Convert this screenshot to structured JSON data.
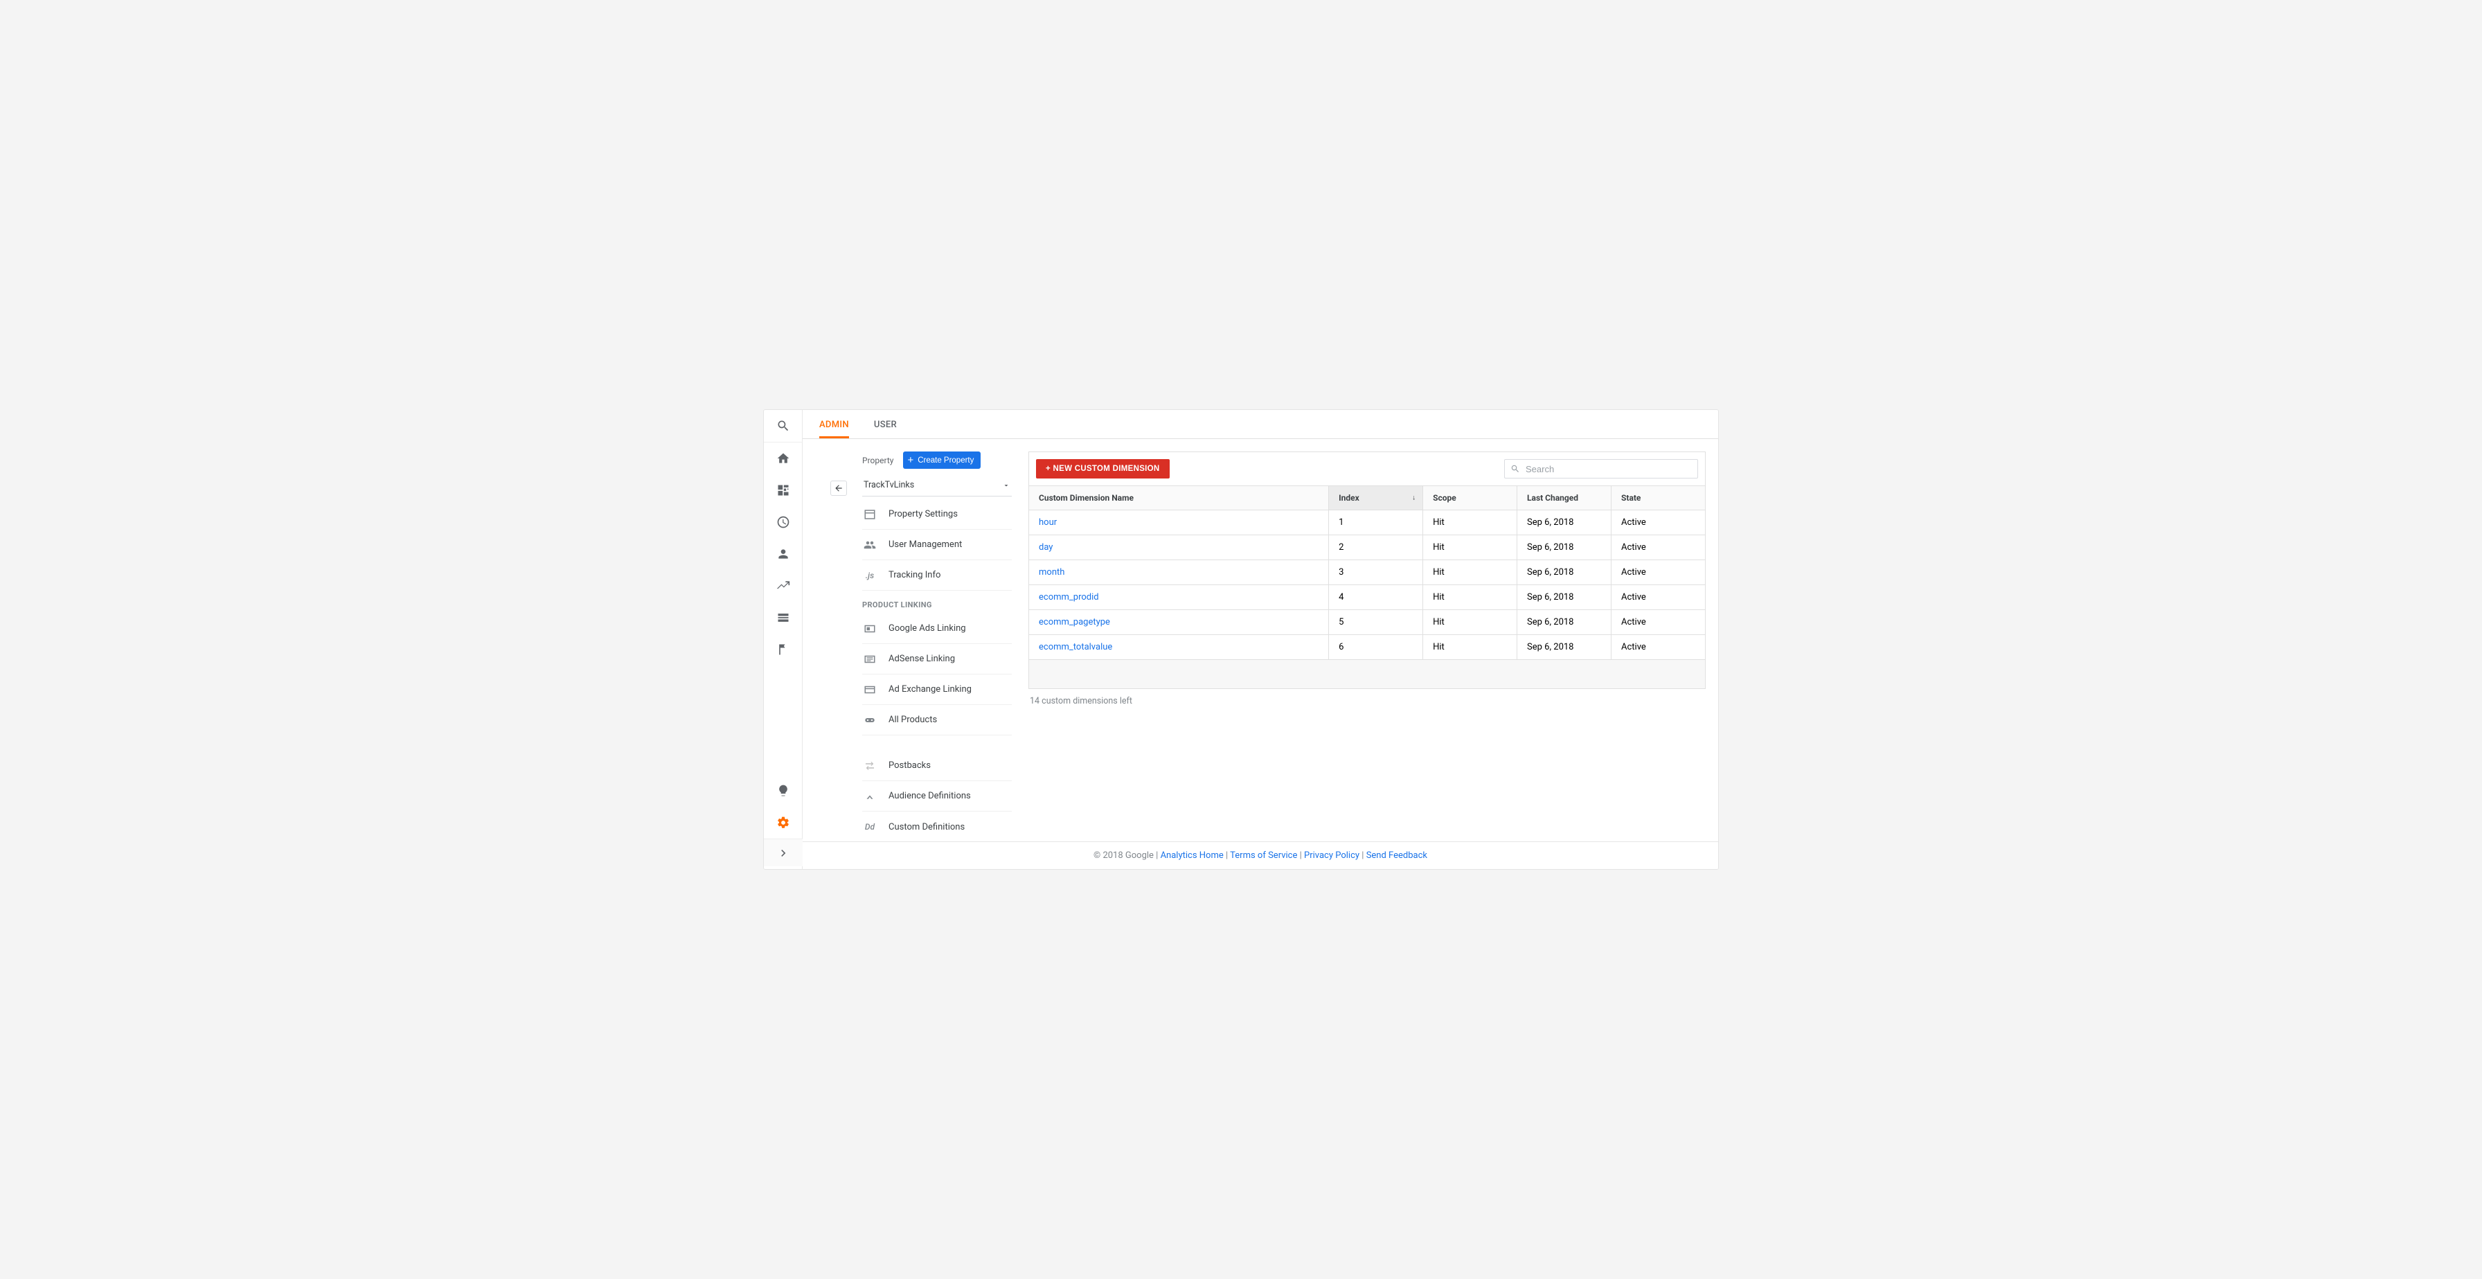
{
  "tabs": {
    "admin": "ADMIN",
    "user": "USER"
  },
  "property": {
    "label": "Property",
    "create_button": "Create Property",
    "selected": "TrackTvLinks"
  },
  "sidebar": {
    "items": [
      {
        "key": "property-settings",
        "label": "Property Settings"
      },
      {
        "key": "user-management",
        "label": "User Management"
      },
      {
        "key": "tracking-info",
        "label": "Tracking Info"
      }
    ],
    "section_title": "PRODUCT LINKING",
    "linking": [
      {
        "key": "google-ads-linking",
        "label": "Google Ads Linking"
      },
      {
        "key": "adsense-linking",
        "label": "AdSense Linking"
      },
      {
        "key": "ad-exchange-linking",
        "label": "Ad Exchange Linking"
      },
      {
        "key": "all-products",
        "label": "All Products"
      }
    ],
    "extra": [
      {
        "key": "postbacks",
        "label": "Postbacks"
      },
      {
        "key": "audience-definitions",
        "label": "Audience Definitions"
      },
      {
        "key": "custom-definitions",
        "label": "Custom Definitions"
      }
    ]
  },
  "table": {
    "new_button": "+ NEW CUSTOM DIMENSION",
    "search_placeholder": "Search",
    "columns": {
      "name": "Custom Dimension Name",
      "index": "Index",
      "scope": "Scope",
      "last_changed": "Last Changed",
      "state": "State"
    },
    "rows": [
      {
        "name": "hour",
        "index": "1",
        "scope": "Hit",
        "last_changed": "Sep 6, 2018",
        "state": "Active"
      },
      {
        "name": "day",
        "index": "2",
        "scope": "Hit",
        "last_changed": "Sep 6, 2018",
        "state": "Active"
      },
      {
        "name": "month",
        "index": "3",
        "scope": "Hit",
        "last_changed": "Sep 6, 2018",
        "state": "Active"
      },
      {
        "name": "ecomm_prodid",
        "index": "4",
        "scope": "Hit",
        "last_changed": "Sep 6, 2018",
        "state": "Active"
      },
      {
        "name": "ecomm_pagetype",
        "index": "5",
        "scope": "Hit",
        "last_changed": "Sep 6, 2018",
        "state": "Active"
      },
      {
        "name": "ecomm_totalvalue",
        "index": "6",
        "scope": "Hit",
        "last_changed": "Sep 6, 2018",
        "state": "Active"
      }
    ],
    "remaining": "14 custom dimensions left"
  },
  "footer": {
    "copyright": "© 2018 Google",
    "links": {
      "home": "Analytics Home",
      "tos": "Terms of Service",
      "privacy": "Privacy Policy",
      "feedback": "Send Feedback"
    }
  }
}
